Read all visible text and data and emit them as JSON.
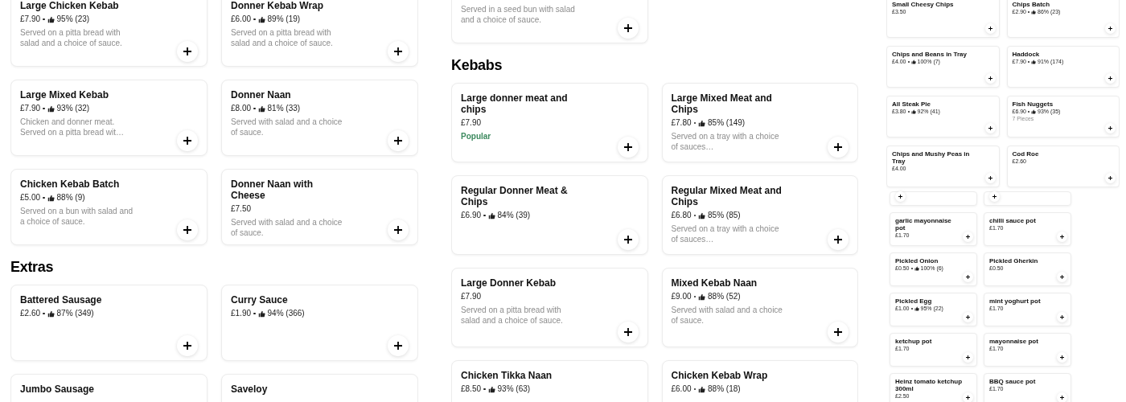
{
  "panels": [
    {
      "kind": "column",
      "sections": [
        {
          "items": [
            {
              "kind": "item",
              "title": "Large Chicken Kebab",
              "price": "£7.90",
              "rating": "95% (23)",
              "description": "Served on a pitta bread with salad and a choice of sauce."
            },
            {
              "kind": "item",
              "title": "Donner Kebab Wrap",
              "price": "£6.00",
              "rating": "89% (19)",
              "description": "Served on a pitta bread with salad and a choice of sauce."
            },
            {
              "kind": "item",
              "title": "Large Mixed Kebab",
              "price": "£7.90",
              "rating": "93% (32)",
              "description": "Chicken and donner meat. Served on a pitta bread wit…"
            },
            {
              "kind": "item",
              "title": "Donner Naan",
              "price": "£8.00",
              "rating": "81% (33)",
              "description": "Served with salad and a choice of sauce."
            },
            {
              "kind": "item",
              "title": "Chicken Kebab Batch",
              "price": "£5.00",
              "rating": "88% (9)",
              "description": "Served on a bun with salad and a choice of sauce."
            },
            {
              "kind": "item",
              "title": "Donner Naan with Cheese",
              "price": "£7.50",
              "description": "Served with salad and a choice of sauce."
            }
          ]
        },
        {
          "heading": "Extras",
          "items": [
            {
              "kind": "item",
              "title": "Battered Sausage",
              "price": "£2.60",
              "rating": "87% (349)"
            },
            {
              "kind": "item",
              "title": "Curry Sauce",
              "price": "£1.90",
              "rating": "94% (366)"
            },
            {
              "kind": "cut",
              "title": "Jumbo Sausage"
            },
            {
              "kind": "cut",
              "title": "Saveloy"
            }
          ]
        }
      ]
    },
    {
      "kind": "column",
      "sections": [
        {
          "items": [
            {
              "kind": "item",
              "description": "Served in a seed bun with salad and a choice of sauce."
            }
          ]
        },
        {
          "heading": "Kebabs",
          "items": [
            {
              "kind": "item",
              "title": "Large donner meat and chips",
              "price": "£7.90",
              "badge": "Popular"
            },
            {
              "kind": "item",
              "title": "Large Mixed Meat and Chips",
              "price": "£7.80",
              "rating": "85% (149)",
              "description": "Served on a tray with a choice of sauces…"
            },
            {
              "kind": "item",
              "title": "Regular Donner Meat & Chips",
              "price": "£6.90",
              "rating": "84% (39)"
            },
            {
              "kind": "item",
              "title": "Regular Mixed Meat and Chips",
              "price": "£6.80",
              "rating": "85% (85)",
              "description": "Served on a tray with a choice of sauces…"
            },
            {
              "kind": "item",
              "title": "Large Donner Kebab",
              "price": "£7.90",
              "description": "Served on a pitta bread with salad and a choice of sauce."
            },
            {
              "kind": "item",
              "title": "Mixed Kebab Naan",
              "price": "£9.00",
              "rating": "88% (52)",
              "description": "Served with salad and a choice of sauce."
            },
            {
              "kind": "cut",
              "title": "Chicken Tikka Naan",
              "price": "£8.50",
              "rating": "93% (63)"
            },
            {
              "kind": "cut",
              "title": "Chicken Kebab Wrap",
              "price": "£6.00",
              "rating": "88% (18)"
            }
          ]
        }
      ]
    },
    {
      "kind": "preview",
      "sections": [
        {
          "items": [
            {
              "kind": "item",
              "title": "Small Cheesy Chips",
              "price": "£3.50"
            },
            {
              "kind": "item",
              "title": "Chips Batch",
              "price": "£2.90",
              "rating": "86% (23)"
            },
            {
              "kind": "item",
              "title": "Chips and Beans in Tray",
              "price": "£4.00",
              "rating": "100% (7)"
            },
            {
              "kind": "item",
              "title": "Haddock",
              "price": "£7.90",
              "rating": "91% (174)"
            },
            {
              "kind": "item",
              "title": "All Steak Pie",
              "price": "£3.80",
              "rating": "92% (41)"
            },
            {
              "kind": "item",
              "title": "Fish Nuggets",
              "price": "£6.90",
              "rating": "93% (35)",
              "description": "7 Pieces"
            },
            {
              "kind": "item",
              "title": "Chips and Mushy Peas in Tray",
              "price": "£4.00"
            },
            {
              "kind": "item",
              "title": "Cod Roe",
              "price": "£2.60"
            }
          ]
        },
        {
          "items": [
            {
              "kind": "stub"
            },
            {
              "kind": "stub"
            },
            {
              "kind": "item",
              "title": "garlic mayonnaise pot",
              "price": "£1.70"
            },
            {
              "kind": "item",
              "title": "chilli sauce pot",
              "price": "£1.70"
            },
            {
              "kind": "item",
              "title": "Pickled Onion",
              "price": "£0.50",
              "rating": "100% (6)"
            },
            {
              "kind": "item",
              "title": "Pickled Gherkin",
              "price": "£0.50"
            },
            {
              "kind": "item",
              "title": "Pickled Egg",
              "price": "£1.00",
              "rating": "95% (22)"
            },
            {
              "kind": "item",
              "title": "mint yoghurt pot",
              "price": "£1.70"
            },
            {
              "kind": "item",
              "title": "ketchup pot",
              "price": "£1.70"
            },
            {
              "kind": "item",
              "title": "mayonnaise pot",
              "price": "£1.70"
            },
            {
              "kind": "item",
              "title": "Heinz tomato ketchup 300ml",
              "price": "£2.50"
            },
            {
              "kind": "item",
              "title": "BBQ sauce pot",
              "price": "£1.70"
            }
          ]
        }
      ]
    }
  ]
}
